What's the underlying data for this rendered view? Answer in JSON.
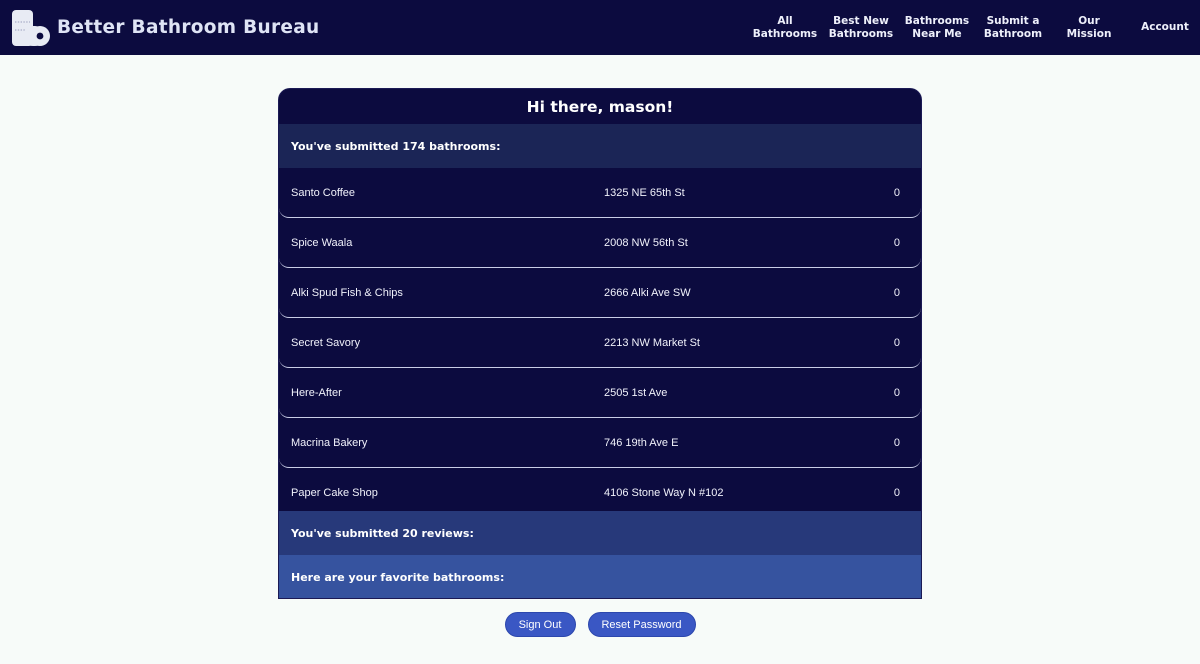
{
  "nav": {
    "brand": "Better Bathroom Bureau",
    "logo_icon": "toilet-paper-icon",
    "links": [
      {
        "label": "All\nBathrooms"
      },
      {
        "label": "Best New\nBathrooms"
      },
      {
        "label": "Bathrooms\nNear Me"
      },
      {
        "label": "Submit a\nBathroom"
      },
      {
        "label": "Our\nMission"
      },
      {
        "label": "Account"
      }
    ]
  },
  "profile": {
    "greeting": "Hi there, mason!",
    "bathrooms_heading": "You've submitted 174 bathrooms:",
    "bathrooms": [
      {
        "name": "Santo Coffee",
        "address": "1325 NE 65th St",
        "count": "0"
      },
      {
        "name": "Spice Waala",
        "address": "2008 NW 56th St",
        "count": "0"
      },
      {
        "name": "Alki Spud Fish & Chips",
        "address": "2666 Alki Ave SW",
        "count": "0"
      },
      {
        "name": "Secret Savory",
        "address": "2213 NW Market St",
        "count": "0"
      },
      {
        "name": "Here-After",
        "address": "2505 1st Ave",
        "count": "0"
      },
      {
        "name": "Macrina Bakery",
        "address": "746 19th Ave E",
        "count": "0"
      },
      {
        "name": "Paper Cake Shop",
        "address": "4106 Stone Way N #102",
        "count": "0"
      }
    ],
    "reviews_heading": "You've submitted 20 reviews:",
    "favorites_heading": "Here are your favorite bathrooms:"
  },
  "actions": {
    "sign_out": "Sign Out",
    "reset_password": "Reset Password"
  },
  "colors": {
    "nav_bg": "#0c0b3f",
    "card_bg": "#0c0b3f",
    "page_bg": "#f7fbf9",
    "button_bg": "#3a57c4"
  }
}
